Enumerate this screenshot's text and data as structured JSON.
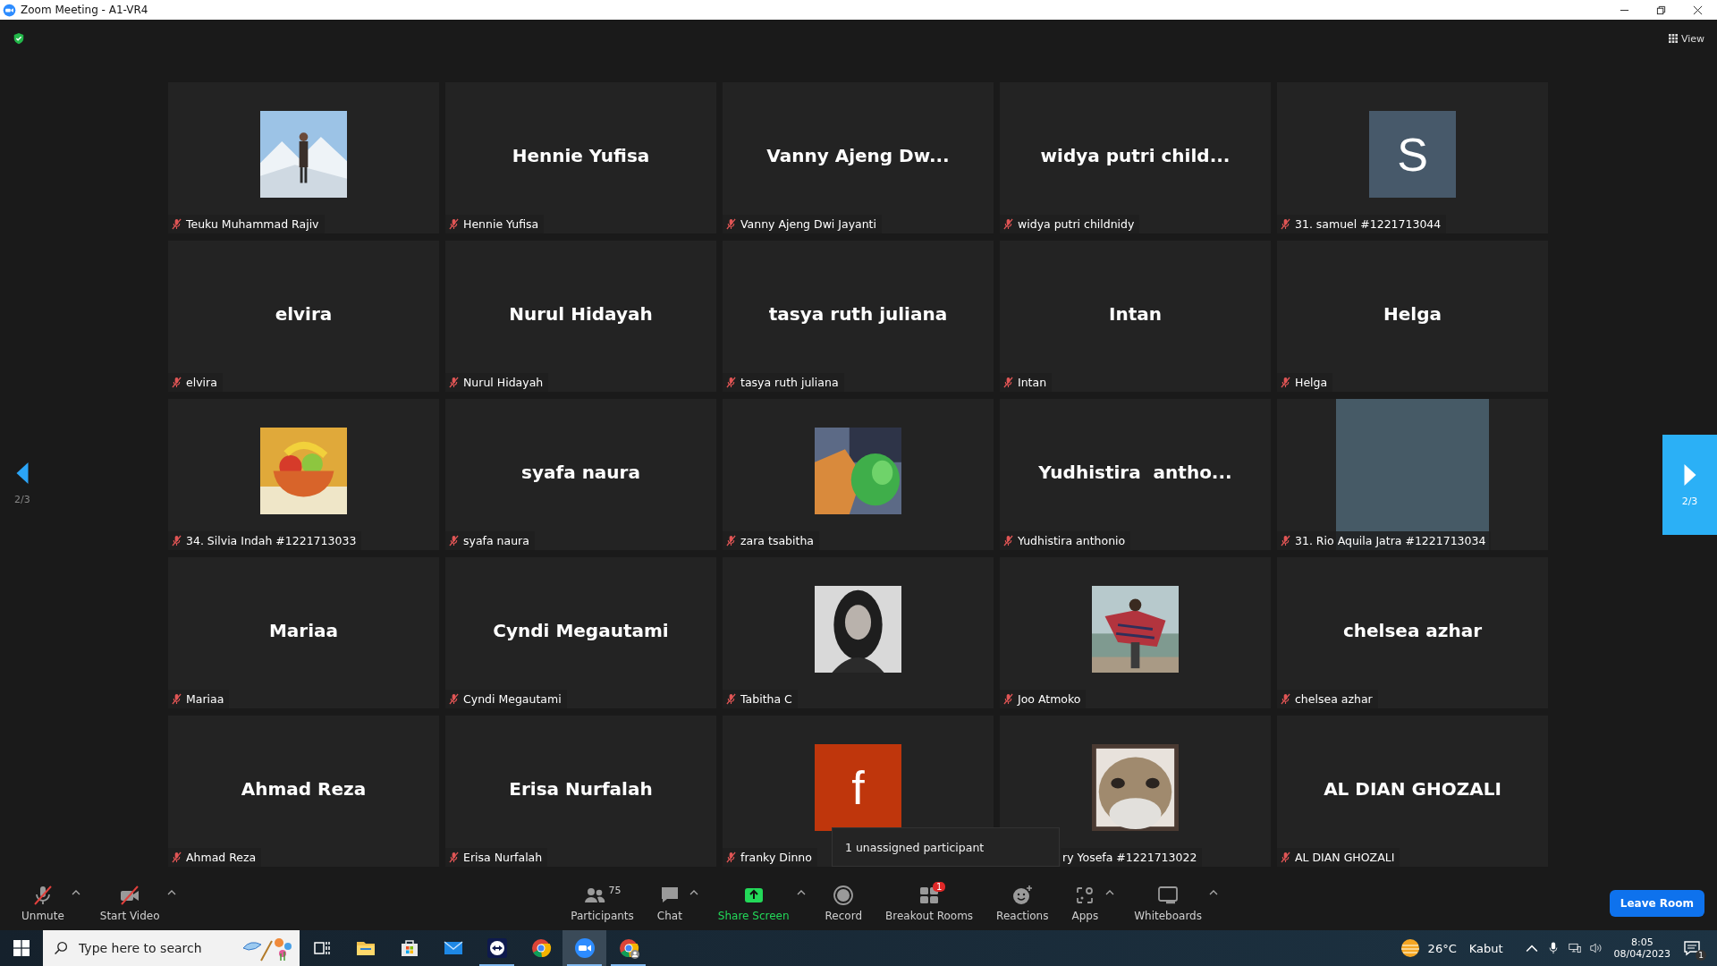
{
  "window": {
    "title": "Zoom Meeting - A1-VR4"
  },
  "view_button": {
    "label": "View"
  },
  "pager": {
    "previous_label": "2/3",
    "next_label": "2/3"
  },
  "tiles": [
    {
      "kind": "picture",
      "label": "Teuku Muhammad Rajiv",
      "muted": true
    },
    {
      "kind": "name",
      "display_name": "Hennie Yufisa",
      "label": "Hennie Yufisa",
      "muted": true
    },
    {
      "kind": "name",
      "display_name": "Vanny Ajeng Dw...",
      "label": "Vanny Ajeng Dwi Jayanti",
      "muted": true
    },
    {
      "kind": "name",
      "display_name": "widya putri child...",
      "label": "widya putri childnidy",
      "muted": true
    },
    {
      "kind": "letter",
      "letter": "S",
      "color": "#47596a",
      "label": "31. samuel #1221713044",
      "muted": true
    },
    {
      "kind": "name",
      "display_name": "elvira",
      "label": "elvira",
      "muted": true
    },
    {
      "kind": "name",
      "display_name": "Nurul Hidayah",
      "label": "Nurul Hidayah",
      "muted": true
    },
    {
      "kind": "name",
      "display_name": "tasya ruth juliana",
      "label": "tasya ruth juliana",
      "muted": true
    },
    {
      "kind": "name",
      "display_name": "Intan",
      "label": "Intan",
      "muted": true
    },
    {
      "kind": "name",
      "display_name": "Helga",
      "label": "Helga",
      "muted": true
    },
    {
      "kind": "picture",
      "label": "34. Silvia Indah #1221713033",
      "muted": true
    },
    {
      "kind": "name",
      "display_name": "syafa naura",
      "label": "syafa naura",
      "muted": true
    },
    {
      "kind": "picture",
      "label": "zara tsabitha",
      "muted": true
    },
    {
      "kind": "name",
      "display_name": "Yudhistira  antho...",
      "label": "Yudhistira anthonio",
      "muted": true
    },
    {
      "kind": "block",
      "color": "#465a66",
      "label": "31. Rio Aquila Jatra #1221713034",
      "muted": true
    },
    {
      "kind": "name",
      "display_name": "Mariaa",
      "label": "Mariaa",
      "muted": true
    },
    {
      "kind": "name",
      "display_name": "Cyndi Megautami",
      "label": "Cyndi Megautami",
      "muted": true
    },
    {
      "kind": "picture",
      "label": "Tabitha C",
      "muted": true
    },
    {
      "kind": "picture",
      "label": "Joo Atmoko",
      "muted": true
    },
    {
      "kind": "name",
      "display_name": "chelsea azhar",
      "label": "chelsea azhar",
      "muted": true
    },
    {
      "kind": "name",
      "display_name": "Ahmad Reza",
      "label": "Ahmad Reza",
      "muted": true
    },
    {
      "kind": "name",
      "display_name": "Erisa Nurfalah",
      "label": "Erisa Nurfalah",
      "muted": true
    },
    {
      "kind": "letter",
      "letter": "f",
      "color": "#bf360c",
      "label": "franky Dinno",
      "muted": true
    },
    {
      "kind": "picture",
      "label": "ry Yosefa #1221713022",
      "label_under_popup": true
    },
    {
      "kind": "name",
      "display_name": "AL DIAN GHOZALI",
      "label": "AL DIAN GHOZALI",
      "muted": true
    }
  ],
  "popup": {
    "text": "1 unassigned participant"
  },
  "toolbar": {
    "items": [
      {
        "kind": "mic-off",
        "label": "Unmute",
        "caret": true
      },
      {
        "kind": "video-off",
        "label": "Start Video",
        "caret": true
      },
      {
        "kind": "spacer"
      },
      {
        "kind": "participants",
        "label": "Participants",
        "count": "75",
        "caret": false
      },
      {
        "kind": "chat",
        "label": "Chat",
        "caret": true
      },
      {
        "kind": "share",
        "label": "Share Screen",
        "caret": true
      },
      {
        "kind": "record",
        "label": "Record",
        "caret": false
      },
      {
        "kind": "breakout",
        "label": "Breakout Rooms",
        "badge": "1",
        "caret": false
      },
      {
        "kind": "reactions",
        "label": "Reactions",
        "caret": false
      },
      {
        "kind": "apps",
        "label": "Apps",
        "caret": true
      },
      {
        "kind": "whiteboard",
        "label": "Whiteboards",
        "caret": true
      }
    ],
    "leave_button": "Leave Room"
  },
  "taskbar": {
    "search_placeholder": "Type here to search",
    "apps": [
      {
        "kind": "taskview",
        "running": false,
        "selected": false
      },
      {
        "kind": "folder",
        "running": false,
        "selected": false
      },
      {
        "kind": "store",
        "running": false,
        "selected": false
      },
      {
        "kind": "mail",
        "running": false,
        "selected": false
      },
      {
        "kind": "teamviewer",
        "running": true,
        "selected": false
      },
      {
        "kind": "chrome",
        "running": false,
        "selected": false
      },
      {
        "kind": "zoom",
        "running": true,
        "selected": true
      },
      {
        "kind": "chrome-profile",
        "running": true,
        "selected": false
      }
    ],
    "weather": {
      "temperature": "26°C",
      "condition": "Kabut"
    },
    "time": "8:05",
    "date": "08/04/2023",
    "notification_count": "1"
  }
}
